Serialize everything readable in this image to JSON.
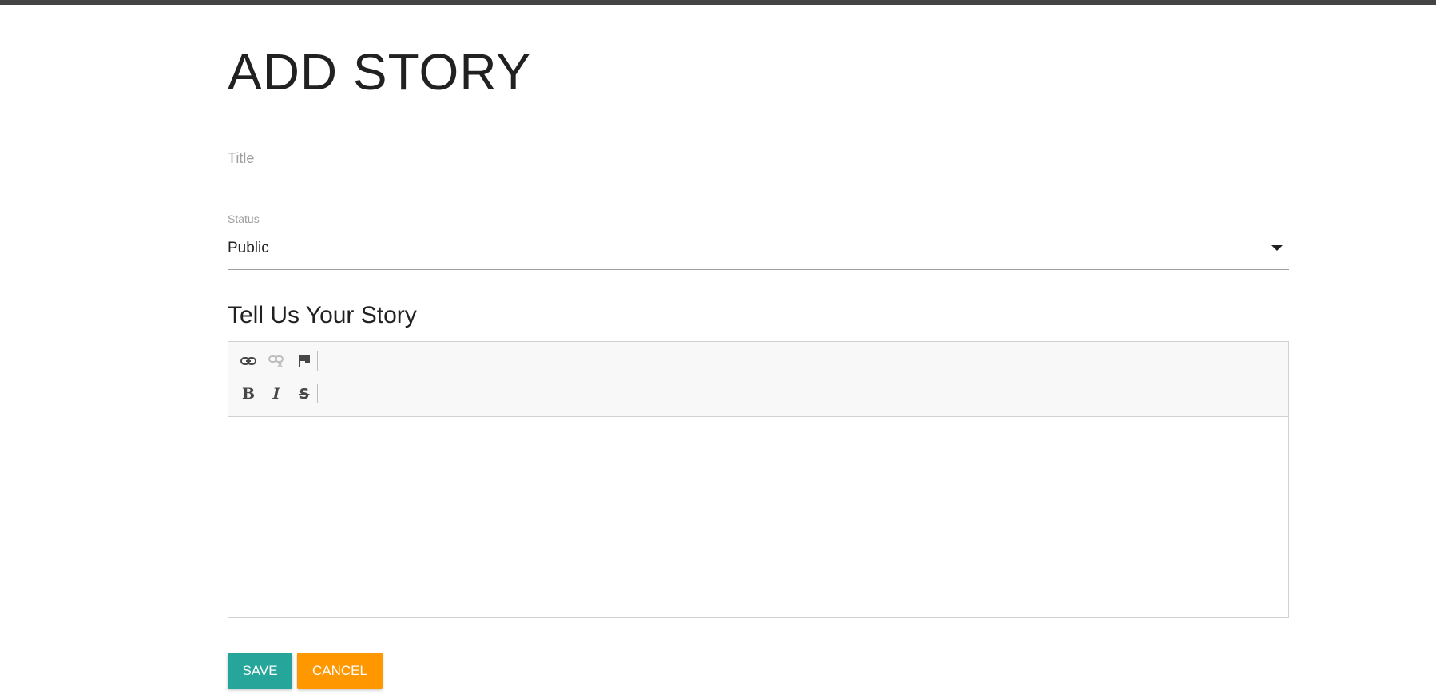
{
  "page": {
    "title": "ADD STORY"
  },
  "form": {
    "title_placeholder": "Title",
    "title_value": "",
    "status_label": "Status",
    "status_value": "Public",
    "story_heading": "Tell Us Your Story",
    "save_label": "SAVE",
    "cancel_label": "CANCEL"
  },
  "toolbar": {
    "row1": [
      {
        "icon": "link-icon"
      },
      {
        "icon": "unlink-icon",
        "disabled": true
      },
      {
        "icon": "flag-icon"
      }
    ],
    "row2": [
      {
        "icon": "bold-icon",
        "glyph": "B"
      },
      {
        "icon": "italic-icon",
        "glyph": "I"
      },
      {
        "icon": "strikethrough-icon",
        "glyph": "S"
      }
    ]
  },
  "colors": {
    "save": "#26a69a",
    "cancel": "#ff9800",
    "topbar": "#444444"
  }
}
